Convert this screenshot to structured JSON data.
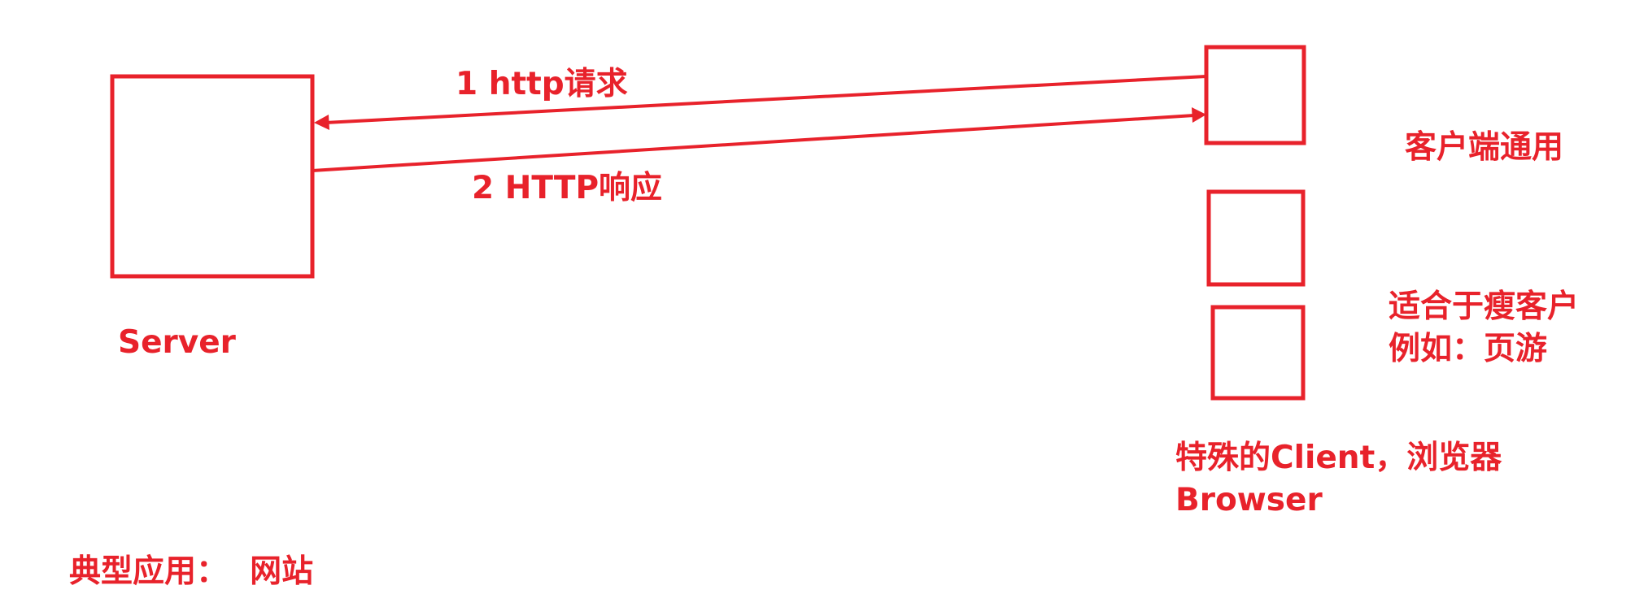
{
  "colors": {
    "accent": "#e8222b",
    "background": "#ffffff"
  },
  "labels": {
    "request": "1 http请求",
    "response": "2   HTTP响应",
    "server": "Server",
    "client_general": "客户端通用",
    "thin_client_line1": "适合于瘦客户",
    "thin_client_line2": "例如：页游",
    "browser_line1": "特殊的Client，浏览器",
    "browser_line2": "Browser",
    "typical_use": "典型应用：  网站"
  }
}
